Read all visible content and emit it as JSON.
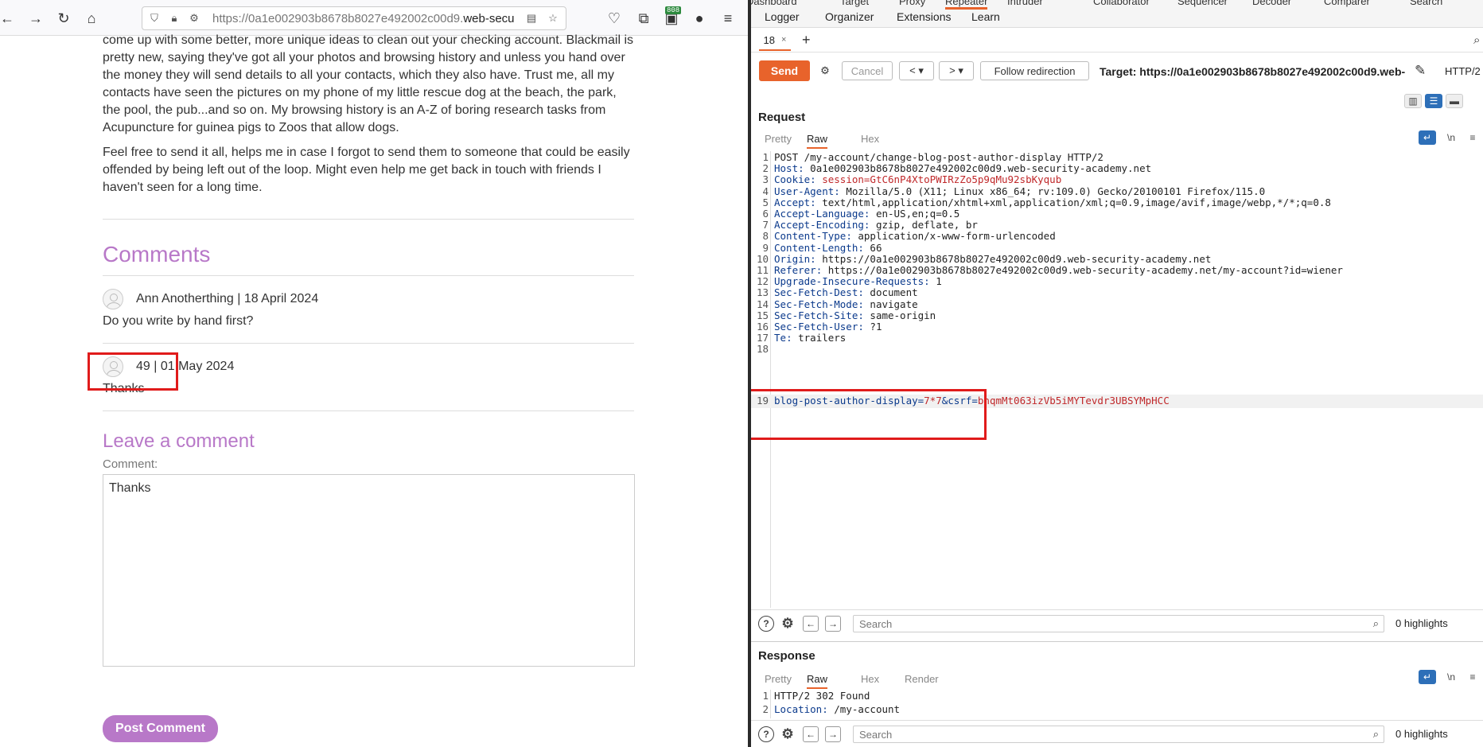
{
  "browser": {
    "url_prefix": "https://0a1e002903b8678b8027e492002c00d9.",
    "url_domain": "web-securit",
    "ext_badge": "808",
    "paragraphs": [
      "come up with some better, more unique ideas to clean out your checking account. Blackmail is pretty new, saying they've got all your photos and browsing history and unless you hand over the money they will send details to all your contacts, which they also have. Trust me, all my contacts have seen the pictures on my phone of my little rescue dog at the beach, the park, the pool, the pub...and so on. My browsing history is an A-Z of boring research tasks from Acupuncture for guinea pigs to Zoos that allow dogs.",
      "Feel free to send it all, helps me in case I forgot to send them to someone that could be easily offended by being left out of the loop. Might even help me get back in touch with friends I haven't seen for a long time."
    ],
    "comments_title": "Comments",
    "comments": [
      {
        "meta": "Ann Anotherthing | 18 April 2024",
        "body": "Do you write by hand first?"
      },
      {
        "meta": "49 | 01 May 2024",
        "body": "Thanks"
      }
    ],
    "leave_title": "Leave a comment",
    "comment_label": "Comment:",
    "comment_value": "Thanks",
    "post_button": "Post Comment"
  },
  "burp": {
    "top_tabs": [
      "Dashboard",
      "Target",
      "Proxy",
      "Intruder",
      "Repeater",
      "Collaborator",
      "Sequencer",
      "Decoder",
      "Comparer",
      "Search"
    ],
    "menu": [
      "Logger",
      "Organizer",
      "Extensions",
      "Learn"
    ],
    "repeater_tab": "18",
    "send": "Send",
    "cancel": "Cancel",
    "follow": "Follow redirection",
    "target": "Target: https://0a1e002903b8678b8027e492002c00d9.web-...",
    "http_version": "HTTP/2",
    "request_title": "Request",
    "request_views": [
      "Pretty",
      "Raw",
      "Hex"
    ],
    "request_lines": [
      {
        "n": "1",
        "k": "",
        "v": "POST /my-account/change-blog-post-author-display HTTP/2"
      },
      {
        "n": "2",
        "k": "Host",
        "v": " 0a1e002903b8678b8027e492002c00d9.web-security-academy.net"
      },
      {
        "n": "3",
        "k": "Cookie",
        "v": " session=GtC6nP4XtoPWIRzZo5p9qMu92sbKyqub"
      },
      {
        "n": "4",
        "k": "User-Agent",
        "v": " Mozilla/5.0 (X11; Linux x86_64; rv:109.0) Gecko/20100101 Firefox/115.0"
      },
      {
        "n": "5",
        "k": "Accept",
        "v": " text/html,application/xhtml+xml,application/xml;q=0.9,image/avif,image/webp,*/*;q=0.8"
      },
      {
        "n": "6",
        "k": "Accept-Language",
        "v": " en-US,en;q=0.5"
      },
      {
        "n": "7",
        "k": "Accept-Encoding",
        "v": " gzip, deflate, br"
      },
      {
        "n": "8",
        "k": "Content-Type",
        "v": " application/x-www-form-urlencoded"
      },
      {
        "n": "9",
        "k": "Content-Length",
        "v": " 66"
      },
      {
        "n": "10",
        "k": "Origin",
        "v": " https://0a1e002903b8678b8027e492002c00d9.web-security-academy.net"
      },
      {
        "n": "11",
        "k": "Referer",
        "v": " https://0a1e002903b8678b8027e492002c00d9.web-security-academy.net/my-account?id=wiener"
      },
      {
        "n": "12",
        "k": "Upgrade-Insecure-Requests",
        "v": " 1"
      },
      {
        "n": "13",
        "k": "Sec-Fetch-Dest",
        "v": " document"
      },
      {
        "n": "14",
        "k": "Sec-Fetch-Mode",
        "v": " navigate"
      },
      {
        "n": "15",
        "k": "Sec-Fetch-Site",
        "v": " same-origin"
      },
      {
        "n": "16",
        "k": "Sec-Fetch-User",
        "v": " ?1"
      },
      {
        "n": "17",
        "k": "Te",
        "v": " trailers"
      },
      {
        "n": "18",
        "k": "",
        "v": ""
      }
    ],
    "body_line": {
      "n": "19",
      "p1": "blog-post-author-display",
      "eq1": "=",
      "v1": "7*7",
      "amp": "&",
      "p2": "csrf",
      "eq2": "=",
      "v2": "bhqmMt063izVb5iMYTevdr3UBSYMpHCC"
    },
    "search_placeholder": "Search",
    "highlights": "0 highlights",
    "response_title": "Response",
    "response_views": [
      "Pretty",
      "Raw",
      "Hex",
      "Render"
    ],
    "response_lines": [
      {
        "n": "1",
        "k": "",
        "v": "HTTP/2 302 Found"
      },
      {
        "n": "2",
        "k": "Location",
        "v": " /my-account"
      }
    ],
    "colors": {
      "accent": "#e8632b",
      "annotation": "#e01b1b",
      "blog_heading": "#b878c8"
    }
  }
}
